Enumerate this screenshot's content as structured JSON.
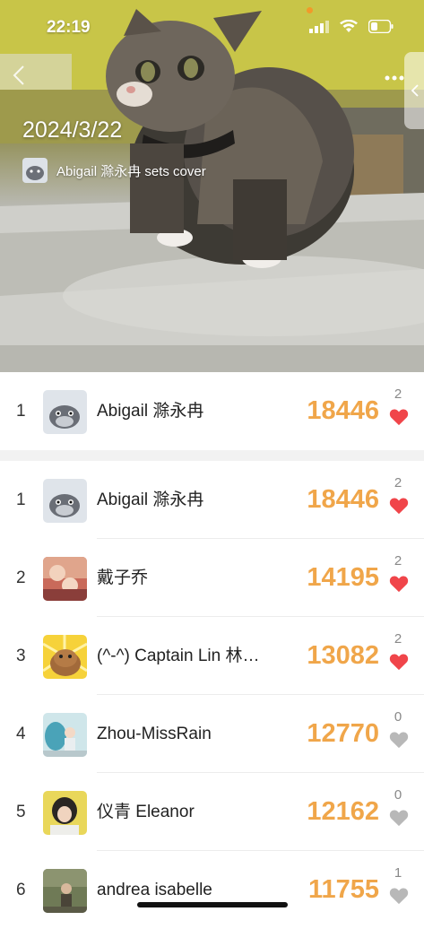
{
  "status_bar": {
    "time": "22:19"
  },
  "header": {
    "date": "2024/3/22",
    "cover_text": "Abigail 滁永冉 sets cover",
    "back_icon": "chevron-left-icon",
    "more_icon": "more-dots-icon",
    "side_tab_icon": "chevron-left-icon"
  },
  "my_rank": {
    "rank": "1",
    "name": "Abigail 滁永冉",
    "steps": "18446",
    "likes": "2",
    "liked": true
  },
  "leaderboard": [
    {
      "rank": "1",
      "name": "Abigail 滁永冉",
      "steps": "18446",
      "likes": "2",
      "liked": true
    },
    {
      "rank": "2",
      "name": "戴子乔",
      "steps": "14195",
      "likes": "2",
      "liked": true
    },
    {
      "rank": "3",
      "name": "(^-^) Captain Lin 林…",
      "steps": "13082",
      "likes": "2",
      "liked": true
    },
    {
      "rank": "4",
      "name": "Zhou-MissRain",
      "steps": "12770",
      "likes": "0",
      "liked": false
    },
    {
      "rank": "5",
      "name": "仪青 Eleanor",
      "steps": "12162",
      "likes": "0",
      "liked": false
    },
    {
      "rank": "6",
      "name": "andrea isabelle",
      "steps": "11755",
      "likes": "1",
      "liked": false
    }
  ],
  "colors": {
    "steps": "#f0a64a",
    "heart_liked": "#f0454a",
    "heart_unliked": "#b8b8b8"
  }
}
